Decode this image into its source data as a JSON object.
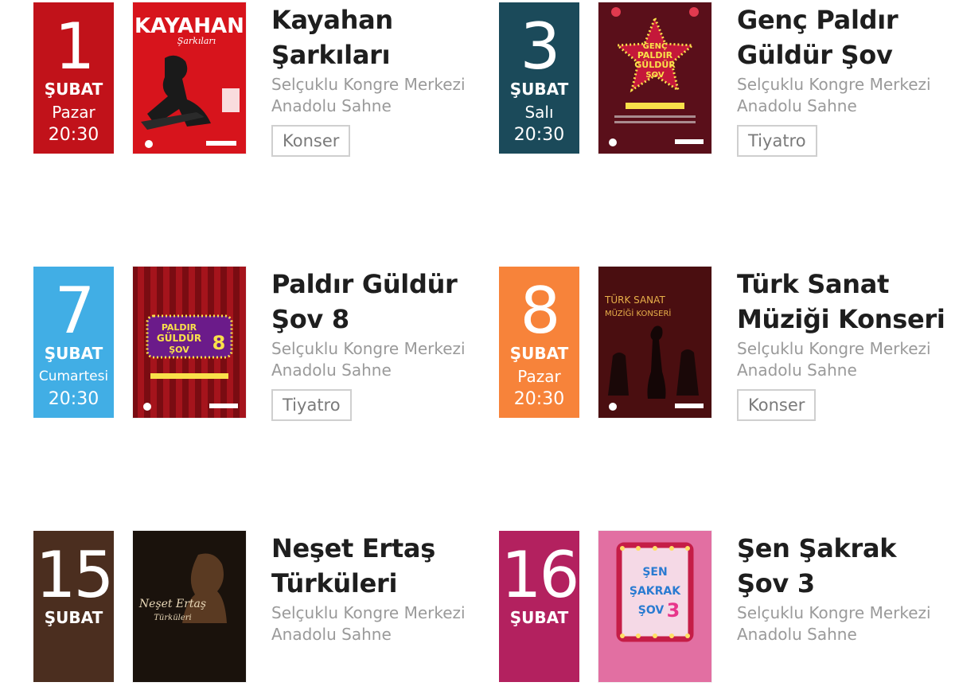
{
  "events": [
    {
      "day": "1",
      "month": "ŞUBAT",
      "weekday": "Pazar",
      "time": "20:30",
      "color": "#c1121a",
      "title1": "Kayahan",
      "title2": "Şarkıları",
      "venue1": "Selçuklu Kongre Merkezi",
      "venue2": "Anadolu Sahne",
      "category": "Konser",
      "poster": {
        "text1": "KAYAHAN",
        "text2": "Şarkıları"
      }
    },
    {
      "day": "3",
      "month": "ŞUBAT",
      "weekday": "Salı",
      "time": "20:30",
      "color": "#1b4a5a",
      "title1": "Genç Paldır",
      "title2": "Güldür Şov",
      "venue1": "Selçuklu Kongre Merkezi",
      "venue2": "Anadolu Sahne",
      "category": "Tiyatro",
      "poster": {
        "text1": "GENÇ",
        "text2": "PALDIR",
        "text3": "GÜLDÜR",
        "text4": "ŞOV"
      }
    },
    {
      "day": "7",
      "month": "ŞUBAT",
      "weekday": "Cumartesi",
      "time": "20:30",
      "color": "#41aee5",
      "title1": "Paldır Güldür",
      "title2": "Şov 8",
      "venue1": "Selçuklu Kongre Merkezi",
      "venue2": "Anadolu Sahne",
      "category": "Tiyatro",
      "poster": {
        "text1": "PALDIR",
        "text2": "GÜLDÜR",
        "text3": "ŞOV",
        "text4": "8"
      }
    },
    {
      "day": "8",
      "month": "ŞUBAT",
      "weekday": "Pazar",
      "time": "20:30",
      "color": "#f7833a",
      "title1": "Türk Sanat",
      "title2": "Müziği Konseri",
      "venue1": "Selçuklu Kongre Merkezi",
      "venue2": "Anadolu Sahne",
      "category": "Konser",
      "poster": {
        "text1": "TÜRK SANAT",
        "text2": "MÜZİĞİ KONSERİ"
      }
    },
    {
      "day": "15",
      "month": "ŞUBAT",
      "weekday": "",
      "time": "",
      "color": "#4b2e1f",
      "title1": "Neşet Ertaş",
      "title2": "Türküleri",
      "venue1": "Selçuklu Kongre Merkezi",
      "venue2": "Anadolu Sahne",
      "category": "",
      "poster": {
        "text1": "Neşet Ertaş",
        "text2": "Türküleri"
      }
    },
    {
      "day": "16",
      "month": "ŞUBAT",
      "weekday": "",
      "time": "",
      "color": "#b3215f",
      "title1": "Şen Şakrak",
      "title2": "Şov 3",
      "venue1": "Selçuklu Kongre Merkezi",
      "venue2": "Anadolu Sahne",
      "category": "",
      "poster": {
        "text1": "ŞEN",
        "text2": "ŞAKRAK",
        "text3": "ŞOV",
        "text4": "3"
      }
    }
  ]
}
